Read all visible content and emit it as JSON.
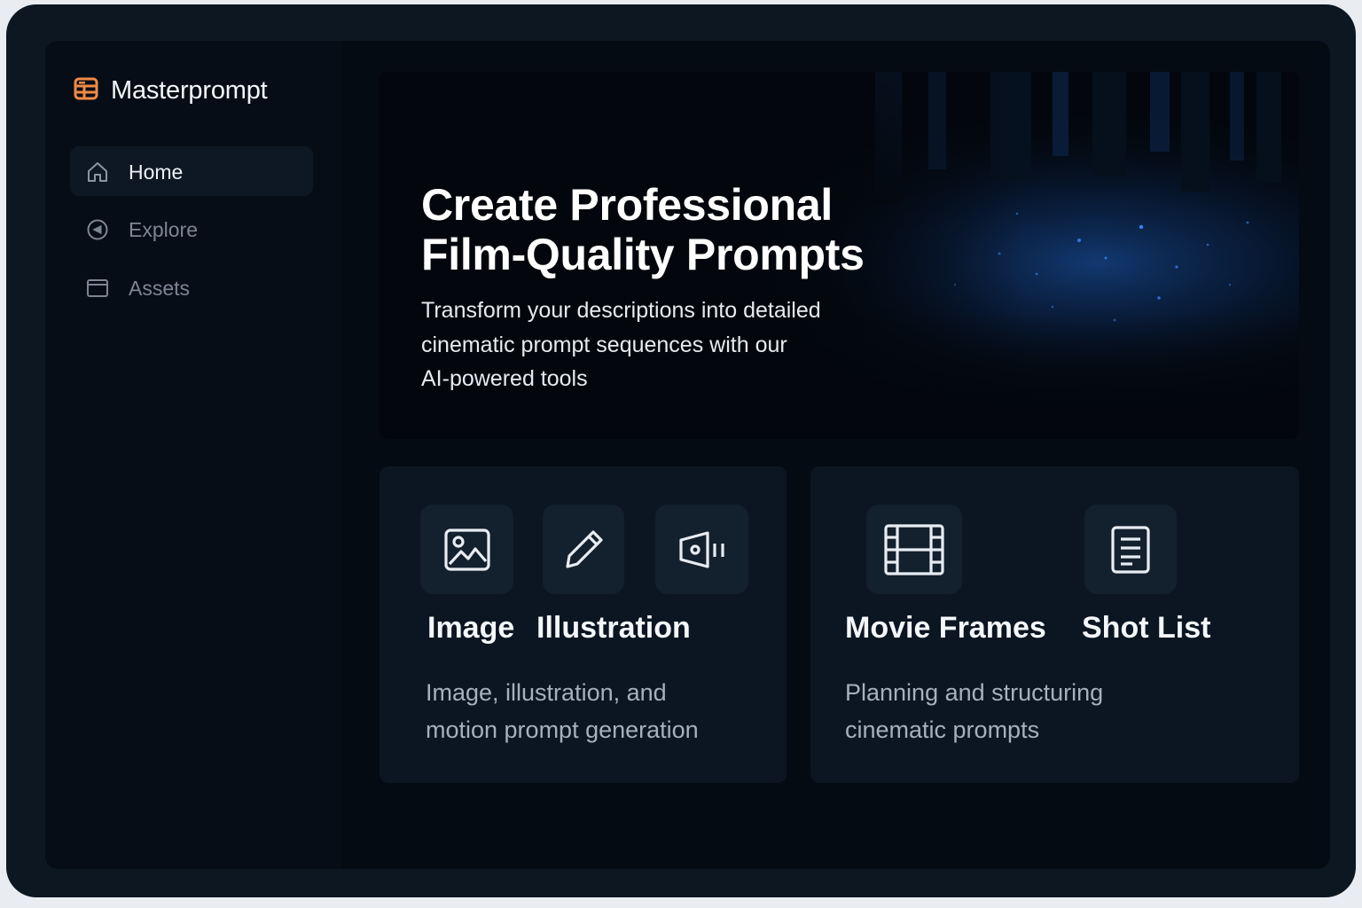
{
  "app": {
    "name": "Masterprompt",
    "logo_icon": "layout-icon",
    "accent": "#f08a44"
  },
  "sidebar": {
    "items": [
      {
        "label": "Home",
        "icon": "home-icon",
        "active": true
      },
      {
        "label": "Explore",
        "icon": "compass-icon",
        "active": false
      },
      {
        "label": "Assets",
        "icon": "folder-icon",
        "active": false
      }
    ]
  },
  "hero": {
    "title_line1": "Create Professional",
    "title_line2": "Film-Quality Prompts",
    "subtitle_line1": "Transform your descriptions into detailed",
    "subtitle_line2": "cinematic prompt sequences with our",
    "subtitle_line3": "AI-powered tools",
    "background": "dark forest with glowing blue particles"
  },
  "cards": [
    {
      "features": [
        {
          "label": "Image",
          "icon": "image-icon"
        },
        {
          "label": "Illustration",
          "icon": "pencil-icon"
        },
        {
          "label": "",
          "icon": "video-camera-icon"
        }
      ],
      "desc_line1": "Image, illustration, and",
      "desc_line2": "motion prompt generation"
    },
    {
      "features": [
        {
          "label": "Movie Frames",
          "icon": "film-strip-icon"
        },
        {
          "label": "Shot List",
          "icon": "document-icon"
        }
      ],
      "desc_line1": "Planning and structuring",
      "desc_line2": "cinematic prompts"
    }
  ],
  "colors": {
    "frame": "#0d1722",
    "screen": "#050b13",
    "card": "#0c1622",
    "tile": "#13202e",
    "glow": "#1f5fbf"
  }
}
